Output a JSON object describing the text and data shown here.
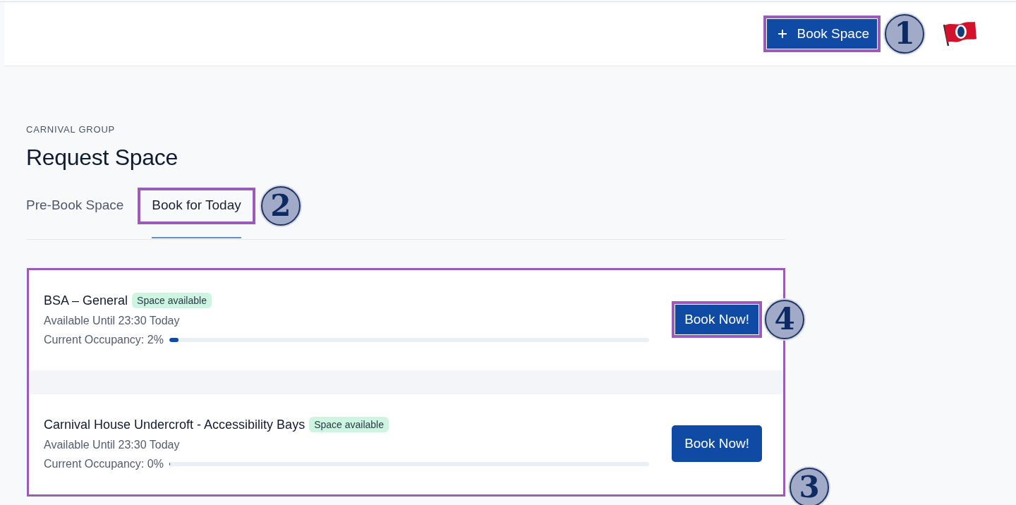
{
  "header": {
    "book_button": {
      "label": "Book Space",
      "highlighted": true,
      "marker": "1"
    }
  },
  "page": {
    "eyebrow": "CARNIVAL GROUP",
    "title": "Request Space"
  },
  "tabs": [
    {
      "label": "Pre-Book Space",
      "selected": false,
      "highlighted": false
    },
    {
      "label": "Book for Today",
      "selected": true,
      "highlighted": true,
      "marker": "2"
    }
  ],
  "spaces": {
    "highlighted": true,
    "marker": "3",
    "items": [
      {
        "name": "BSA – General",
        "badge": "Space available",
        "availability": "Available Until 23:30 Today",
        "occupancy": "Current Occupancy: 2%",
        "level": 0.02,
        "button": {
          "label": "Book Now!",
          "highlighted": true,
          "marker": "4"
        }
      },
      {
        "name": "Carnival House Undercroft - Accessibility Bays",
        "badge": "Space available",
        "availability": "Available Until 23:30 Today",
        "occupancy": "Current Occupancy: 0%",
        "level": 0,
        "button": {
          "label": "Book Now!",
          "highlighted": false
        }
      }
    ]
  }
}
